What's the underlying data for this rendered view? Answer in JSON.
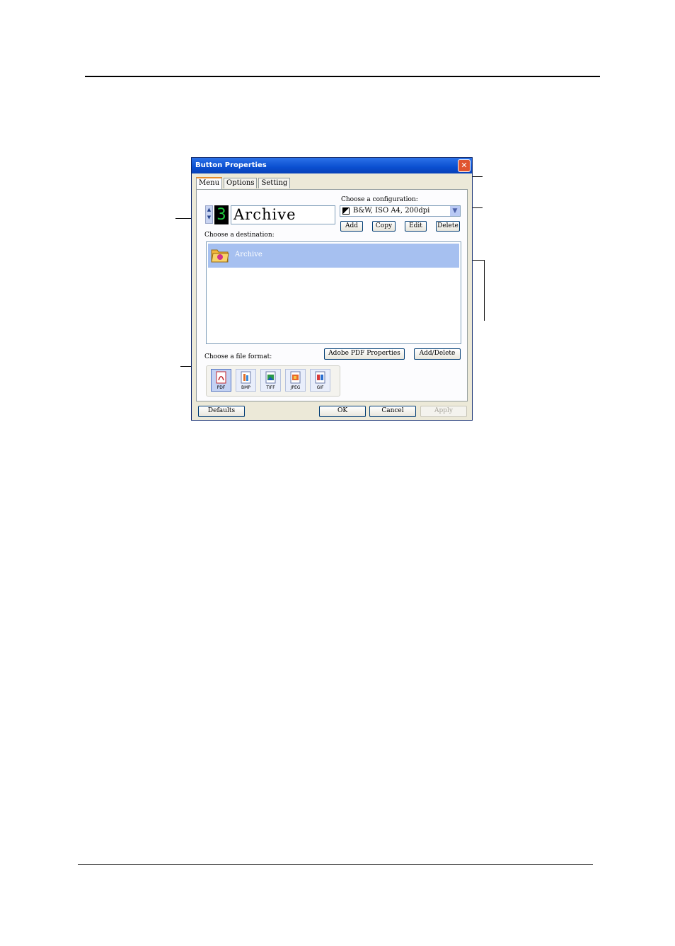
{
  "dialog": {
    "title": "Button Properties",
    "tabs": [
      {
        "label": "Menu",
        "active": true
      },
      {
        "label": "Options",
        "active": false
      },
      {
        "label": "Setting",
        "active": false
      }
    ],
    "button_number": "3",
    "button_name": "Archive",
    "configuration": {
      "label": "Choose a configuration:",
      "selected": "B&W, ISO A4, 200dpi",
      "buttons": {
        "add": "Add",
        "copy": "Copy",
        "edit": "Edit",
        "delete": "Delete"
      }
    },
    "destination": {
      "label": "Choose a destination:",
      "items": [
        {
          "label": "Archive",
          "icon": "folder-icon",
          "selected": true
        }
      ],
      "adobe_pdf_properties": "Adobe PDF Properties",
      "add_delete": "Add/Delete"
    },
    "file_format": {
      "label": "Choose a file format:",
      "formats": [
        {
          "label": "PDF",
          "selected": true
        },
        {
          "label": "BMP",
          "selected": false
        },
        {
          "label": "TIFF",
          "selected": false
        },
        {
          "label": "JPEG",
          "selected": false
        },
        {
          "label": "GIF",
          "selected": false
        }
      ]
    },
    "footer": {
      "defaults": "Defaults",
      "ok": "OK",
      "cancel": "Cancel",
      "apply": "Apply",
      "apply_enabled": false
    },
    "colors": {
      "titlebar": "#0a4fd0",
      "selection": "#a6c0f0",
      "digit": "#1ec83c"
    }
  }
}
